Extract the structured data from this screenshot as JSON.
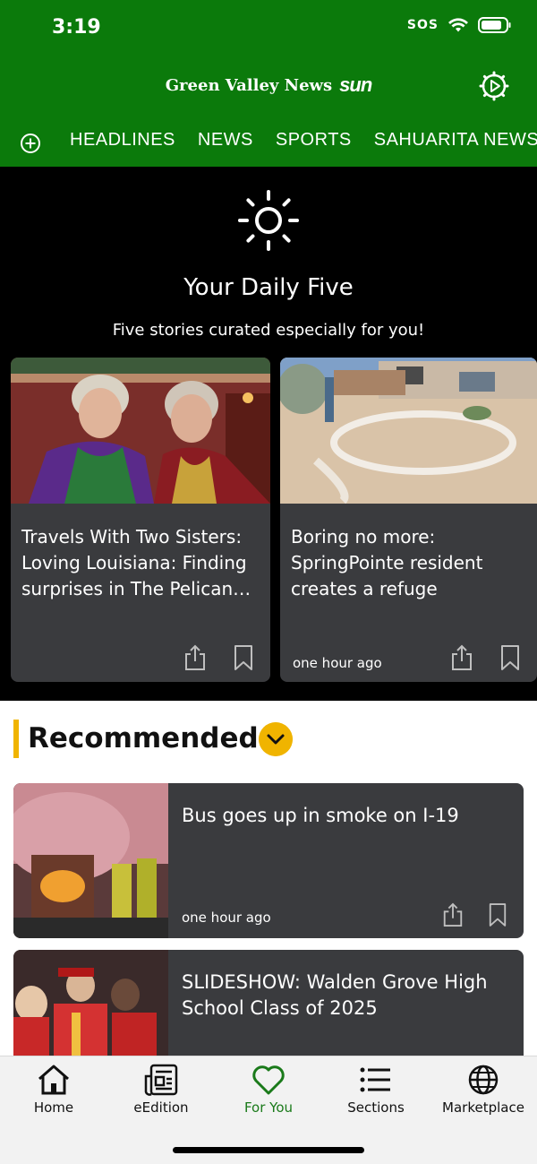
{
  "status": {
    "time": "3:19",
    "sos": "SOS"
  },
  "header": {
    "brand_name": "Green Valley News",
    "brand_sun": "sun",
    "nav_tabs": [
      "HEADLINES",
      "NEWS",
      "SPORTS",
      "SAHUARITA NEWS"
    ],
    "background": "#0b7a0b"
  },
  "daily": {
    "title": "Your Daily Five",
    "subtitle": "Five stories curated especially for you!",
    "cards": [
      {
        "title": "Travels With Two Sisters: Loving Louisiana: Finding surprises in The Pelican…",
        "time": ""
      },
      {
        "title": "Boring no more: SpringPointe resident creates a refuge",
        "time": "one hour ago"
      }
    ]
  },
  "recommended": {
    "title": "Recommended",
    "accent": "#f0b400",
    "items": [
      {
        "title": "Bus goes up in smoke on I-19",
        "time": "one hour ago"
      },
      {
        "title": "SLIDESHOW: Walden Grove High School Class of 2025",
        "time": ""
      }
    ]
  },
  "tabbar": {
    "items": [
      {
        "label": "Home",
        "icon": "home-icon"
      },
      {
        "label": "eEdition",
        "icon": "newspaper-icon"
      },
      {
        "label": "For You",
        "icon": "heart-icon",
        "active": true
      },
      {
        "label": "Sections",
        "icon": "list-icon"
      },
      {
        "label": "Marketplace",
        "icon": "globe-icon"
      }
    ],
    "active_color": "#1a7a1a"
  }
}
